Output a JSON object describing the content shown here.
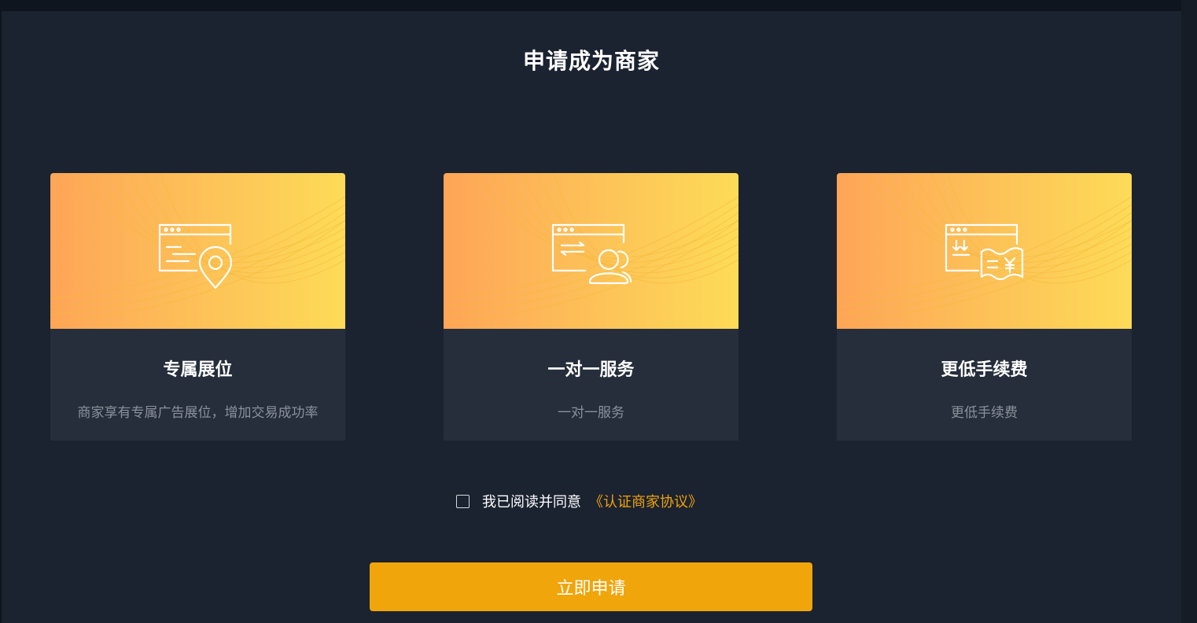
{
  "page": {
    "title": "申请成为商家"
  },
  "cards": [
    {
      "title": "专属展位",
      "desc": "商家享有专属广告展位，增加交易成功率",
      "icon": "display-location-icon"
    },
    {
      "title": "一对一服务",
      "desc": "一对一服务",
      "icon": "transfer-user-icon"
    },
    {
      "title": "更低手续费",
      "desc": "更低手续费",
      "icon": "fee-ticket-icon"
    }
  ],
  "agreement": {
    "checked": false,
    "text": "我已阅读并同意",
    "link": "《认证商家协议》"
  },
  "apply_button": {
    "label": "立即申请"
  },
  "colors": {
    "background": "#1b2230",
    "card_body": "#262e3b",
    "accent": "#f0a50b",
    "link": "#f0a30a",
    "banner_start": "#fea557",
    "banner_end": "#fddb57"
  }
}
